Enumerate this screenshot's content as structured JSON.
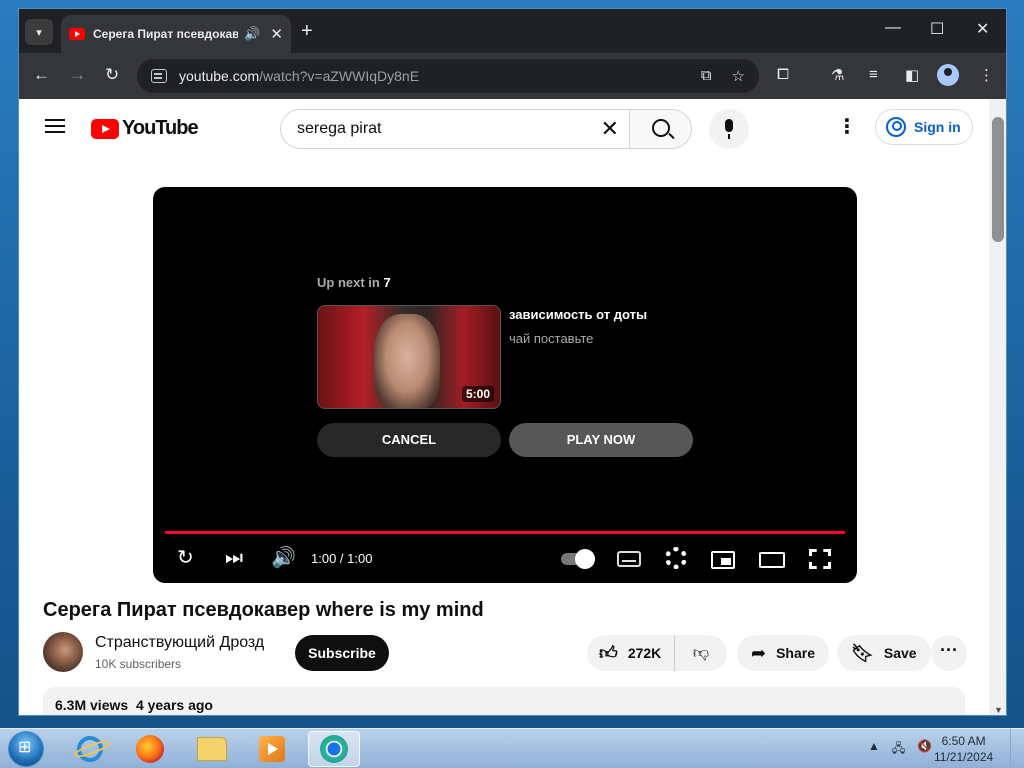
{
  "browser": {
    "tab_title": "Серега Пират псевдокавер where is my mind",
    "tab_switch_icon": "chevron-down-icon",
    "new_tab_label": "+",
    "window_controls": {
      "minimize": "—",
      "maximize": "☐",
      "close": "✕"
    },
    "back": "←",
    "forward": "→",
    "reload": "↻",
    "url_host": "youtube.com",
    "url_path": "/watch?v=aZWWIqDy8nE",
    "omnibox_icons": [
      "install-app-icon",
      "bookmark-star-icon"
    ],
    "toolbar_icons": [
      "extensions-icon",
      "labs-flask-icon",
      "media-control-icon",
      "side-panel-icon",
      "profile-icon",
      "menu-kebab-icon"
    ]
  },
  "youtube": {
    "logo_text": "YouTube",
    "search_value": "serega pirat",
    "signin_label": "Sign in",
    "accent": "#ff0000",
    "link_color": "#065fd4"
  },
  "player": {
    "upnext_prefix": "Up next in",
    "upnext_seconds": "7",
    "next_video_title": "зависимость от доты",
    "next_video_channel": "чай поставьте",
    "next_video_duration": "5:00",
    "cancel_label": "CANCEL",
    "play_now_label": "PLAY NOW",
    "time": "1:00 / 1:00",
    "progress_percent": 100,
    "progress_color": "#ff0033"
  },
  "video": {
    "title": "Серега Пират псевдокавер where is my mind",
    "channel_name": "Странствующий Дрозд",
    "channel_subs": "10K subscribers",
    "subscribe_label": "Subscribe",
    "likes": "272K",
    "share_label": "Share",
    "save_label": "Save",
    "more_label": "···",
    "views": "6.3M views",
    "age": "4 years ago"
  },
  "taskbar": {
    "apps": [
      "internet-explorer-icon",
      "firefox-icon",
      "file-explorer-icon",
      "media-player-icon",
      "chrome-icon"
    ],
    "active_app": "chrome-icon",
    "tray_icons": [
      "show-hidden-icons",
      "network-icon",
      "volume-muted-icon"
    ],
    "time": "6:50 AM",
    "date": "11/21/2024"
  }
}
